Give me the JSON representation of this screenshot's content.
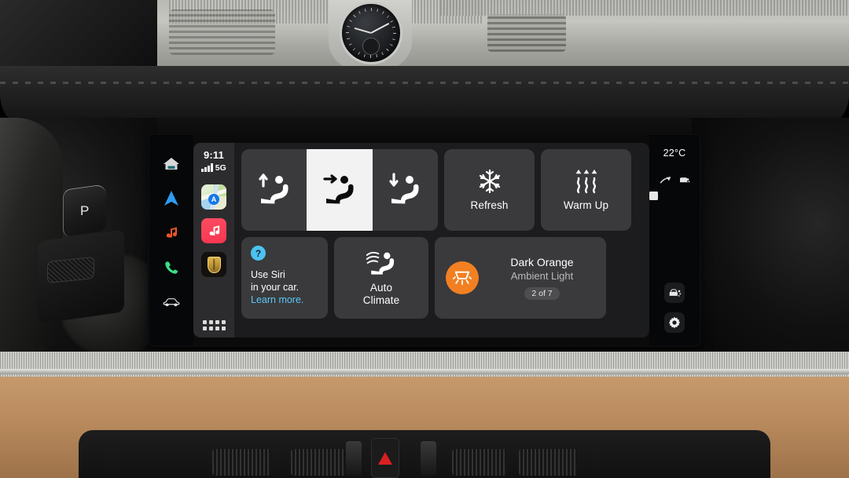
{
  "vehicle": {
    "gear_indicator": "P",
    "hazard_icon": "hazard-triangle-icon",
    "gauge_icon": "analog-clock-gauge"
  },
  "display": {
    "left_rail": {
      "items": [
        {
          "name": "home-icon",
          "label": "Home"
        },
        {
          "name": "navigation-arrow-icon",
          "label": "Navigation"
        },
        {
          "name": "music-note-icon",
          "label": "Media"
        },
        {
          "name": "phone-icon",
          "label": "Phone"
        },
        {
          "name": "car-icon",
          "label": "Vehicle"
        }
      ]
    },
    "right_panel": {
      "temperature": "22°C",
      "icons": [
        {
          "name": "defrost-icon",
          "label": "Defrost"
        },
        {
          "name": "seat-climate-icon",
          "label": "Seat Climate"
        },
        {
          "name": "rear-window-icon",
          "label": "Rear Window"
        }
      ],
      "buttons": [
        {
          "name": "climate-button",
          "label": "Climate"
        },
        {
          "name": "settings-gear-button",
          "label": "Settings"
        }
      ]
    }
  },
  "carplay": {
    "status": {
      "time": "9:11",
      "network": "5G",
      "signal_bars": 4
    },
    "sidebar_apps": [
      {
        "name": "app-icon-maps",
        "label": "Maps"
      },
      {
        "name": "app-icon-music",
        "label": "Music"
      },
      {
        "name": "app-icon-porsche",
        "label": "Porsche"
      }
    ],
    "grid_button": {
      "name": "app-launcher-grid",
      "label": "All Apps"
    },
    "airflow": {
      "options": [
        {
          "name": "airflow-up",
          "label": "Airflow Up",
          "selected": false
        },
        {
          "name": "airflow-forward",
          "label": "Airflow Forward",
          "selected": true
        },
        {
          "name": "airflow-down",
          "label": "Airflow Down",
          "selected": false
        }
      ]
    },
    "tiles": {
      "refresh": {
        "label": "Refresh",
        "icon": "snowflake-icon"
      },
      "warm_up": {
        "label": "Warm Up",
        "icon": "heat-waves-icon"
      },
      "auto_climate": {
        "label_line1": "Auto",
        "label_line2": "Climate",
        "icon": "auto-climate-seat-icon"
      }
    },
    "siri_card": {
      "badge": "?",
      "line1": "Use Siri",
      "line2": "in your car.",
      "link": "Learn more."
    },
    "ambient_light": {
      "title": "Dark Orange",
      "subtitle": "Ambient Light",
      "badge": "2 of 7",
      "color": "#F28022",
      "icon": "ambient-lamp-icon"
    }
  },
  "colors": {
    "carplay_background": "#1c1c1e",
    "tile_background": "#3a3a3c",
    "sidebar_background": "#2c2c2e",
    "accent_blue": "#5ac8f5",
    "ambient_orange": "#F28022",
    "selected_tile": "#f2f2f2"
  }
}
